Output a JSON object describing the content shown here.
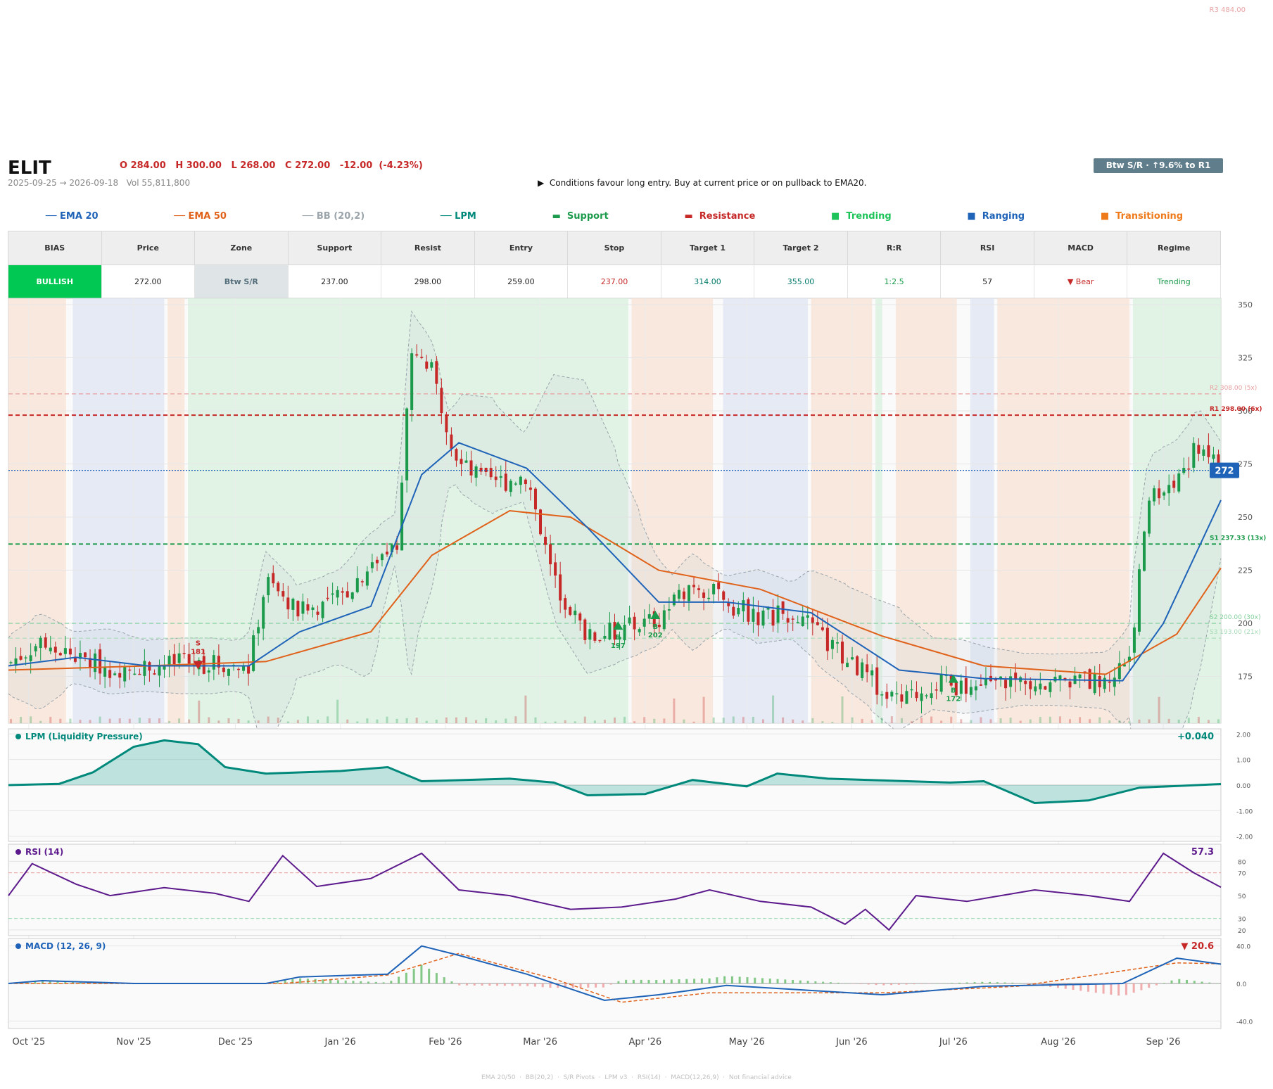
{
  "header": {
    "ticker": "ELIT",
    "ohlc": "O 284.00   H 300.00   L 268.00   C 272.00   -12.00  (-4.23%)",
    "date_range": "2025-09-25 → 2026-09-18   Vol 55,811,800",
    "zone_badge": "Btw S/R  ·  ↑9.6% to R1",
    "conditions": "▶  Conditions favour long entry. Buy at current price or on pullback to EMA20."
  },
  "legend": [
    {
      "label": "── EMA 20",
      "color": "#1e63b8"
    },
    {
      "label": "── EMA 50",
      "color": "#e0621a"
    },
    {
      "label": "── BB (20,2)",
      "color": "#9aa4aa"
    },
    {
      "label": "── LPM",
      "color": "#00897b"
    },
    {
      "label": "▬  Support",
      "color": "#1a9a4a"
    },
    {
      "label": "▬  Resistance",
      "color": "#c62828"
    },
    {
      "label": "■  Trending",
      "color": "#1ec45a"
    },
    {
      "label": "■  Ranging",
      "color": "#1e63b8"
    },
    {
      "label": "■  Transitioning",
      "color": "#ef7a1a"
    }
  ],
  "table": {
    "headers": [
      "BIAS",
      "Price",
      "Zone",
      "Support",
      "Resist",
      "Entry",
      "Stop",
      "Target 1",
      "Target 2",
      "R:R",
      "RSI",
      "MACD",
      "Regime"
    ],
    "values": [
      {
        "text": "BULLISH",
        "color": "#ffffff",
        "bg": "#00c853"
      },
      {
        "text": "272.00",
        "color": "#222222",
        "bg": "#ffffff"
      },
      {
        "text": "Btw S/R",
        "color": "#546e7a",
        "bg": "#dfe4e7"
      },
      {
        "text": "237.00",
        "color": "#222222",
        "bg": "#ffffff"
      },
      {
        "text": "298.00",
        "color": "#222222",
        "bg": "#ffffff"
      },
      {
        "text": "259.00",
        "color": "#222222",
        "bg": "#ffffff"
      },
      {
        "text": "237.00",
        "color": "#c62828",
        "bg": "#ffffff"
      },
      {
        "text": "314.00",
        "color": "#00796b",
        "bg": "#ffffff"
      },
      {
        "text": "355.00",
        "color": "#00796b",
        "bg": "#ffffff"
      },
      {
        "text": "1:2.5",
        "color": "#1a9a4a",
        "bg": "#ffffff"
      },
      {
        "text": "57",
        "color": "#222222",
        "bg": "#ffffff"
      },
      {
        "text": "▼ Bear",
        "color": "#c62828",
        "bg": "#ffffff"
      },
      {
        "text": "Trending",
        "color": "#1a9a4a",
        "bg": "#ffffff"
      }
    ]
  },
  "footer": "EMA 20/50  ·  BB(20,2)  ·  S/R Pivots  ·  LPM v3  ·  RSI(14)  ·  MACD(12,26,9)  ·  Not financial advice",
  "colors": {
    "up": "#1a9a4a",
    "down": "#c62828",
    "ema20": "#1e63b8",
    "ema50": "#e0621a",
    "lpm": "#00897b",
    "rsi": "#5c1a8c",
    "macd": "#1e63b8",
    "signal": "#e0621a",
    "trend_bg": "#d7f0de",
    "range_bg": "#dde4f1",
    "trans_bg": "#f8e2d3"
  },
  "chart_data": [
    {
      "type": "candlestick",
      "title": "",
      "x_ticks": [
        "Oct '25",
        "Nov '25",
        "Dec '25",
        "Jan '26",
        "Feb '26",
        "Mar '26",
        "Apr '26",
        "May '26",
        "Jun '26",
        "Jul '26",
        "Aug '26",
        "Sep '26"
      ],
      "x_range": [
        "2025-09-25",
        "2026-09-18"
      ],
      "y_ticks": [
        175,
        200,
        225,
        250,
        275,
        300,
        325,
        350
      ],
      "ylim": [
        153,
        353
      ],
      "last_price": {
        "value": 272,
        "label": "272"
      },
      "price_series": [
        {
          "date": "2025-09-25",
          "value": 181
        },
        {
          "date": "2025-10-05",
          "value": 192
        },
        {
          "date": "2025-10-15",
          "value": 184
        },
        {
          "date": "2025-10-25",
          "value": 179
        },
        {
          "date": "2025-11-05",
          "value": 180
        },
        {
          "date": "2025-11-15",
          "value": 181
        },
        {
          "date": "2025-11-25",
          "value": 181
        },
        {
          "date": "2025-12-05",
          "value": 179
        },
        {
          "date": "2025-12-10",
          "value": 220
        },
        {
          "date": "2025-12-20",
          "value": 205
        },
        {
          "date": "2026-01-01",
          "value": 212
        },
        {
          "date": "2026-01-10",
          "value": 228
        },
        {
          "date": "2026-01-18",
          "value": 240
        },
        {
          "date": "2026-01-22",
          "value": 330
        },
        {
          "date": "2026-01-28",
          "value": 318
        },
        {
          "date": "2026-02-05",
          "value": 275
        },
        {
          "date": "2026-02-15",
          "value": 265
        },
        {
          "date": "2026-02-25",
          "value": 270
        },
        {
          "date": "2026-03-05",
          "value": 220
        },
        {
          "date": "2026-03-15",
          "value": 193
        },
        {
          "date": "2026-03-25",
          "value": 197
        },
        {
          "date": "2026-04-05",
          "value": 202
        },
        {
          "date": "2026-04-15",
          "value": 220
        },
        {
          "date": "2026-04-25",
          "value": 210
        },
        {
          "date": "2026-05-05",
          "value": 203
        },
        {
          "date": "2026-05-15",
          "value": 205
        },
        {
          "date": "2026-05-25",
          "value": 190
        },
        {
          "date": "2026-06-05",
          "value": 176
        },
        {
          "date": "2026-06-15",
          "value": 162
        },
        {
          "date": "2026-06-25",
          "value": 172
        },
        {
          "date": "2026-07-05",
          "value": 170
        },
        {
          "date": "2026-07-15",
          "value": 172
        },
        {
          "date": "2026-07-25",
          "value": 174
        },
        {
          "date": "2026-08-05",
          "value": 173
        },
        {
          "date": "2026-08-15",
          "value": 172
        },
        {
          "date": "2026-08-22",
          "value": 185
        },
        {
          "date": "2026-08-28",
          "value": 260
        },
        {
          "date": "2026-09-05",
          "value": 268
        },
        {
          "date": "2026-09-12",
          "value": 285
        },
        {
          "date": "2026-09-18",
          "value": 272
        }
      ],
      "ema20": [
        {
          "date": "2025-09-25",
          "value": 180
        },
        {
          "date": "2025-10-15",
          "value": 184
        },
        {
          "date": "2025-11-05",
          "value": 180
        },
        {
          "date": "2025-12-05",
          "value": 180
        },
        {
          "date": "2025-12-20",
          "value": 196
        },
        {
          "date": "2026-01-10",
          "value": 208
        },
        {
          "date": "2026-01-25",
          "value": 270
        },
        {
          "date": "2026-02-05",
          "value": 285
        },
        {
          "date": "2026-02-25",
          "value": 273
        },
        {
          "date": "2026-03-15",
          "value": 245
        },
        {
          "date": "2026-04-05",
          "value": 210
        },
        {
          "date": "2026-04-25",
          "value": 210
        },
        {
          "date": "2026-05-20",
          "value": 205
        },
        {
          "date": "2026-06-15",
          "value": 178
        },
        {
          "date": "2026-07-10",
          "value": 174
        },
        {
          "date": "2026-08-20",
          "value": 173
        },
        {
          "date": "2026-09-01",
          "value": 200
        },
        {
          "date": "2026-09-18",
          "value": 258
        }
      ],
      "ema50": [
        {
          "date": "2025-09-25",
          "value": 178
        },
        {
          "date": "2025-11-05",
          "value": 180
        },
        {
          "date": "2025-12-10",
          "value": 182
        },
        {
          "date": "2026-01-10",
          "value": 196
        },
        {
          "date": "2026-01-28",
          "value": 232
        },
        {
          "date": "2026-02-20",
          "value": 253
        },
        {
          "date": "2026-03-10",
          "value": 250
        },
        {
          "date": "2026-04-05",
          "value": 225
        },
        {
          "date": "2026-05-05",
          "value": 216
        },
        {
          "date": "2026-06-10",
          "value": 194
        },
        {
          "date": "2026-07-10",
          "value": 180
        },
        {
          "date": "2026-08-15",
          "value": 176
        },
        {
          "date": "2026-09-05",
          "value": 195
        },
        {
          "date": "2026-09-18",
          "value": 226
        }
      ],
      "levels": [
        {
          "name": "R3",
          "label": "R3 484.00",
          "value": 484,
          "color": "#e9a3a3"
        },
        {
          "name": "R2",
          "label": "R2 308.00 (5x)",
          "value": 308,
          "color": "#e8a0a0"
        },
        {
          "name": "R1",
          "label": "R1 298.00 (6x)",
          "value": 298,
          "color": "#c62828"
        },
        {
          "name": "S1",
          "label": "S1 237.33 (13x)",
          "value": 237.33,
          "color": "#1a9a4a"
        },
        {
          "name": "S2",
          "label": "S2 200.00 (30x)",
          "value": 200,
          "color": "#7fcf9a"
        },
        {
          "name": "S3",
          "label": "S3 193.00 (21x)",
          "value": 193,
          "color": "#a8dcb8"
        }
      ],
      "signals": [
        {
          "type": "S",
          "date": "2025-11-20",
          "value": 181,
          "label": "181"
        },
        {
          "type": "B",
          "date": "2026-03-24",
          "value": 197,
          "label": "197"
        },
        {
          "type": "B",
          "date": "2026-04-04",
          "value": 202,
          "label": "202"
        },
        {
          "type": "B",
          "date": "2026-07-01",
          "value": 172,
          "label": "172"
        }
      ],
      "regimes": [
        {
          "start": "2025-09-25",
          "end": "2025-10-12",
          "type": "transitioning"
        },
        {
          "start": "2025-10-14",
          "end": "2025-11-10",
          "type": "ranging"
        },
        {
          "start": "2025-11-11",
          "end": "2025-11-16",
          "type": "transitioning"
        },
        {
          "start": "2025-11-17",
          "end": "2026-03-27",
          "type": "trending"
        },
        {
          "start": "2026-03-28",
          "end": "2026-04-21",
          "type": "transitioning"
        },
        {
          "start": "2026-04-24",
          "end": "2026-05-19",
          "type": "ranging"
        },
        {
          "start": "2026-05-20",
          "end": "2026-06-07",
          "type": "transitioning"
        },
        {
          "start": "2026-06-08",
          "end": "2026-06-10",
          "type": "trending"
        },
        {
          "start": "2026-06-14",
          "end": "2026-07-02",
          "type": "transitioning"
        },
        {
          "start": "2026-07-06",
          "end": "2026-07-13",
          "type": "ranging"
        },
        {
          "start": "2026-07-14",
          "end": "2026-08-22",
          "type": "transitioning"
        },
        {
          "start": "2026-08-23",
          "end": "2026-09-18",
          "type": "trending"
        }
      ]
    },
    {
      "type": "area",
      "title": "LPM (Liquidity Pressure)",
      "last_value": "+0.040",
      "y_ticks": [
        "2.00",
        "1.00",
        "0.00",
        "-1.00",
        "-2.00"
      ],
      "ylim": [
        -2.2,
        2.2
      ],
      "series": [
        {
          "date": "2025-09-25",
          "value": 0.0
        },
        {
          "date": "2025-10-10",
          "value": 0.05
        },
        {
          "date": "2025-10-20",
          "value": 0.5
        },
        {
          "date": "2025-11-01",
          "value": 1.5
        },
        {
          "date": "2025-11-10",
          "value": 1.75
        },
        {
          "date": "2025-11-20",
          "value": 1.6
        },
        {
          "date": "2025-11-28",
          "value": 0.7
        },
        {
          "date": "2025-12-10",
          "value": 0.45
        },
        {
          "date": "2026-01-01",
          "value": 0.55
        },
        {
          "date": "2026-01-15",
          "value": 0.7
        },
        {
          "date": "2026-01-25",
          "value": 0.15
        },
        {
          "date": "2026-02-20",
          "value": 0.25
        },
        {
          "date": "2026-03-05",
          "value": 0.1
        },
        {
          "date": "2026-03-15",
          "value": -0.4
        },
        {
          "date": "2026-04-01",
          "value": -0.35
        },
        {
          "date": "2026-04-15",
          "value": 0.2
        },
        {
          "date": "2026-05-01",
          "value": -0.05
        },
        {
          "date": "2026-05-10",
          "value": 0.45
        },
        {
          "date": "2026-05-25",
          "value": 0.25
        },
        {
          "date": "2026-06-30",
          "value": 0.1
        },
        {
          "date": "2026-07-10",
          "value": 0.15
        },
        {
          "date": "2026-07-25",
          "value": -0.7
        },
        {
          "date": "2026-08-10",
          "value": -0.6
        },
        {
          "date": "2026-08-25",
          "value": -0.1
        },
        {
          "date": "2026-09-18",
          "value": 0.04
        }
      ]
    },
    {
      "type": "line",
      "title": "RSI (14)",
      "last_value": "57.3",
      "y_ticks": [
        "80",
        "70",
        "50",
        "30",
        "20"
      ],
      "ylim": [
        15,
        95
      ],
      "series": [
        {
          "date": "2025-09-25",
          "value": 50
        },
        {
          "date": "2025-10-02",
          "value": 78
        },
        {
          "date": "2025-10-15",
          "value": 60
        },
        {
          "date": "2025-10-25",
          "value": 50
        },
        {
          "date": "2025-11-10",
          "value": 57
        },
        {
          "date": "2025-11-25",
          "value": 52
        },
        {
          "date": "2025-12-05",
          "value": 45
        },
        {
          "date": "2025-12-15",
          "value": 85
        },
        {
          "date": "2025-12-25",
          "value": 58
        },
        {
          "date": "2026-01-10",
          "value": 65
        },
        {
          "date": "2026-01-25",
          "value": 87
        },
        {
          "date": "2026-02-05",
          "value": 55
        },
        {
          "date": "2026-02-20",
          "value": 50
        },
        {
          "date": "2026-03-10",
          "value": 38
        },
        {
          "date": "2026-03-25",
          "value": 40
        },
        {
          "date": "2026-04-10",
          "value": 47
        },
        {
          "date": "2026-04-20",
          "value": 55
        },
        {
          "date": "2026-05-05",
          "value": 45
        },
        {
          "date": "2026-05-20",
          "value": 40
        },
        {
          "date": "2026-05-30",
          "value": 25
        },
        {
          "date": "2026-06-05",
          "value": 38
        },
        {
          "date": "2026-06-12",
          "value": 20
        },
        {
          "date": "2026-06-20",
          "value": 50
        },
        {
          "date": "2026-07-05",
          "value": 45
        },
        {
          "date": "2026-07-25",
          "value": 55
        },
        {
          "date": "2026-08-10",
          "value": 50
        },
        {
          "date": "2026-08-22",
          "value": 45
        },
        {
          "date": "2026-09-01",
          "value": 87
        },
        {
          "date": "2026-09-10",
          "value": 70
        },
        {
          "date": "2026-09-18",
          "value": 57.3
        }
      ]
    },
    {
      "type": "line",
      "title": "MACD (12, 26, 9)",
      "last_value": "▼ 20.6",
      "y_ticks": [
        "40.0",
        "0.0",
        "-40.0"
      ],
      "ylim": [
        -48,
        48
      ],
      "macd": [
        {
          "date": "2025-09-25",
          "value": 0
        },
        {
          "date": "2025-10-05",
          "value": 3
        },
        {
          "date": "2025-11-01",
          "value": 0
        },
        {
          "date": "2025-12-10",
          "value": 0
        },
        {
          "date": "2025-12-20",
          "value": 7
        },
        {
          "date": "2026-01-15",
          "value": 10
        },
        {
          "date": "2026-01-25",
          "value": 40
        },
        {
          "date": "2026-02-05",
          "value": 30
        },
        {
          "date": "2026-02-25",
          "value": 10
        },
        {
          "date": "2026-03-20",
          "value": -18
        },
        {
          "date": "2026-04-05",
          "value": -12
        },
        {
          "date": "2026-04-25",
          "value": -2
        },
        {
          "date": "2026-06-10",
          "value": -12
        },
        {
          "date": "2026-07-10",
          "value": -3
        },
        {
          "date": "2026-08-20",
          "value": 0
        },
        {
          "date": "2026-09-05",
          "value": 27
        },
        {
          "date": "2026-09-18",
          "value": 20.6
        }
      ],
      "signal": [
        {
          "date": "2025-09-25",
          "value": 0
        },
        {
          "date": "2025-11-01",
          "value": 0
        },
        {
          "date": "2025-12-15",
          "value": 0
        },
        {
          "date": "2026-01-15",
          "value": 9
        },
        {
          "date": "2026-02-05",
          "value": 32
        },
        {
          "date": "2026-03-05",
          "value": 5
        },
        {
          "date": "2026-03-25",
          "value": -20
        },
        {
          "date": "2026-04-20",
          "value": -10
        },
        {
          "date": "2026-06-10",
          "value": -10
        },
        {
          "date": "2026-07-20",
          "value": -3
        },
        {
          "date": "2026-09-05",
          "value": 22
        },
        {
          "date": "2026-09-18",
          "value": 21
        }
      ]
    }
  ]
}
